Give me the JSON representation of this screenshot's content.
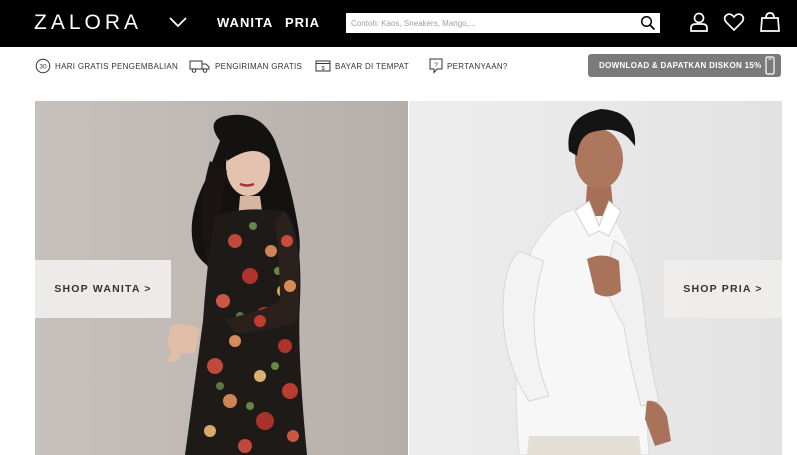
{
  "header": {
    "logo": "ZALORA",
    "nav": [
      "WANITA",
      "PRIA"
    ],
    "search_placeholder": "Contoh: Kaos, Sneakers, Mango,...",
    "icons": [
      "search-icon",
      "user-icon",
      "heart-icon",
      "shopping-bag-icon"
    ],
    "background": "#000000"
  },
  "infobar": {
    "items": [
      {
        "icon": "30-days-return-icon",
        "label": "HARI GRATIS PENGEMBALIAN",
        "badge": "30"
      },
      {
        "icon": "delivery-truck-icon",
        "label": "PENGIRIMAN GRATIS"
      },
      {
        "icon": "cash-on-delivery-icon",
        "label": "BAYAR DI TEMPAT"
      },
      {
        "icon": "question-bubble-icon",
        "label": "PERTANYAAN?"
      }
    ],
    "download_button": "DOWNLOAD & DAPATKAN DISKON 15%",
    "download_color": "#7a7a7a"
  },
  "hero": {
    "left": {
      "button": "SHOP WANITA >"
    },
    "right": {
      "button": "SHOP PRIA >"
    }
  }
}
